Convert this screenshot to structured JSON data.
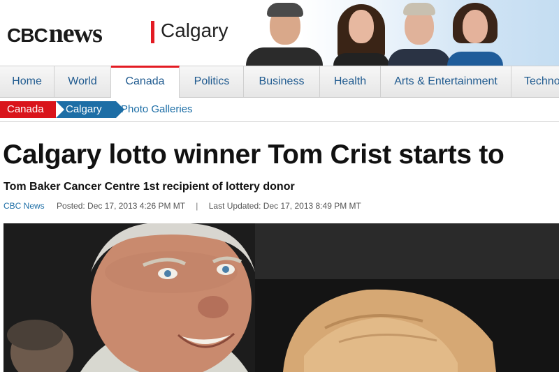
{
  "header": {
    "logo_cbc": "CBC",
    "logo_news": "news",
    "city": "Calgary"
  },
  "nav": {
    "items": [
      {
        "label": "Home"
      },
      {
        "label": "World"
      },
      {
        "label": "Canada"
      },
      {
        "label": "Politics"
      },
      {
        "label": "Business"
      },
      {
        "label": "Health"
      },
      {
        "label": "Arts & Entertainment"
      },
      {
        "label": "Techno"
      }
    ],
    "active": "Canada"
  },
  "breadcrumb": {
    "canada": "Canada",
    "calgary": "Calgary",
    "photo_galleries": "Photo Galleries"
  },
  "article": {
    "headline": "Calgary lotto winner Tom Crist starts to",
    "subheadline": "Tom Baker Cancer Centre 1st recipient of lottery donor",
    "source": "CBC News",
    "posted": "Posted: Dec 17, 2013 4:26 PM MT",
    "separator": "|",
    "updated": "Last Updated: Dec 17, 2013 8:49 PM MT"
  },
  "colors": {
    "brand_red": "#e31b23",
    "link_blue": "#1d6ea6"
  }
}
